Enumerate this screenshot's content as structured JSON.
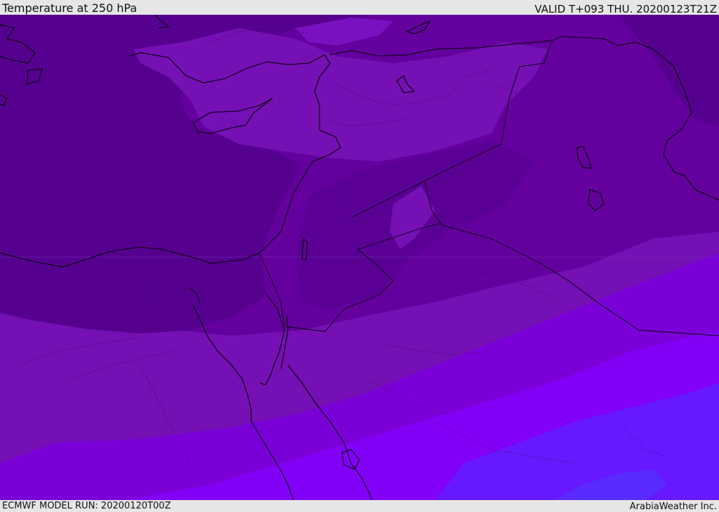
{
  "header": {
    "title": "Temperature at 250 hPa",
    "valid_time": "VALID T+093 THU. 20200123T21Z"
  },
  "footer": {
    "model_run": "ECMWF MODEL RUN: 20200120T00Z",
    "credit": "ArabiaWeather Inc."
  },
  "colors": {
    "band_darkest": "#55008f",
    "band_dark": "#64009e",
    "band_mid": "#7410b4",
    "band_violet": "#7a00d8",
    "band_bright": "#8200f5",
    "band_blue": "#6619ff",
    "coastline": "#000000",
    "frame": "#e6e6e6"
  }
}
